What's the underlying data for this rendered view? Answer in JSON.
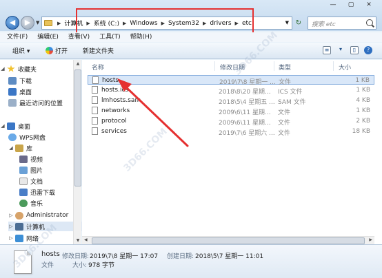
{
  "window": {
    "controls": [
      "—",
      "▢",
      "✕"
    ]
  },
  "address": {
    "crumbs": [
      "计算机",
      "系统 (C:)",
      "Windows",
      "System32",
      "drivers",
      "etc"
    ],
    "search_placeholder": "搜索 etc"
  },
  "menu": [
    "文件(F)",
    "编辑(E)",
    "查看(V)",
    "工具(T)",
    "帮助(H)"
  ],
  "toolbar": {
    "organize": "组织 ▾",
    "open": "打开",
    "new_folder": "新建文件夹"
  },
  "nav": {
    "favorites": "收藏夹",
    "downloads": "下载",
    "desktop_fav": "桌面",
    "recent": "最近访问的位置",
    "desktop": "桌面",
    "wps": "WPS网盘",
    "library": "库",
    "video": "视频",
    "pictures": "图片",
    "documents": "文档",
    "thunder": "迅雷下载",
    "music": "音乐",
    "admin": "Administrator",
    "computer": "计算机",
    "network": "网络"
  },
  "columns": [
    "名称",
    "修改日期",
    "类型",
    "大小"
  ],
  "files": [
    {
      "name": "hosts",
      "date": "2019\\7\\8 星期一 ...",
      "type": "文件",
      "size": "1 KB"
    },
    {
      "name": "hosts.ics",
      "date": "2018\\8\\20 星期...",
      "type": "ICS 文件",
      "size": "1 KB"
    },
    {
      "name": "lmhosts.sam",
      "date": "2018\\5\\4 星期五 ...",
      "type": "SAM 文件",
      "size": "4 KB"
    },
    {
      "name": "networks",
      "date": "2009\\6\\11 星期...",
      "type": "文件",
      "size": "1 KB"
    },
    {
      "name": "protocol",
      "date": "2009\\6\\11 星期...",
      "type": "文件",
      "size": "2 KB"
    },
    {
      "name": "services",
      "date": "2019\\7\\6 星期六 ...",
      "type": "文件",
      "size": "18 KB"
    }
  ],
  "details": {
    "name": "hosts",
    "modified_label": "修改日期:",
    "modified": "2019\\7\\8 星期一 17:07",
    "created_label": "创建日期:",
    "created": "2018\\5\\7 星期一 11:01",
    "type": "文件",
    "size_label": "大小:",
    "size": "978 字节"
  },
  "watermarks": [
    "3D66.COM",
    "3D66.COM",
    "3D66.COM"
  ]
}
